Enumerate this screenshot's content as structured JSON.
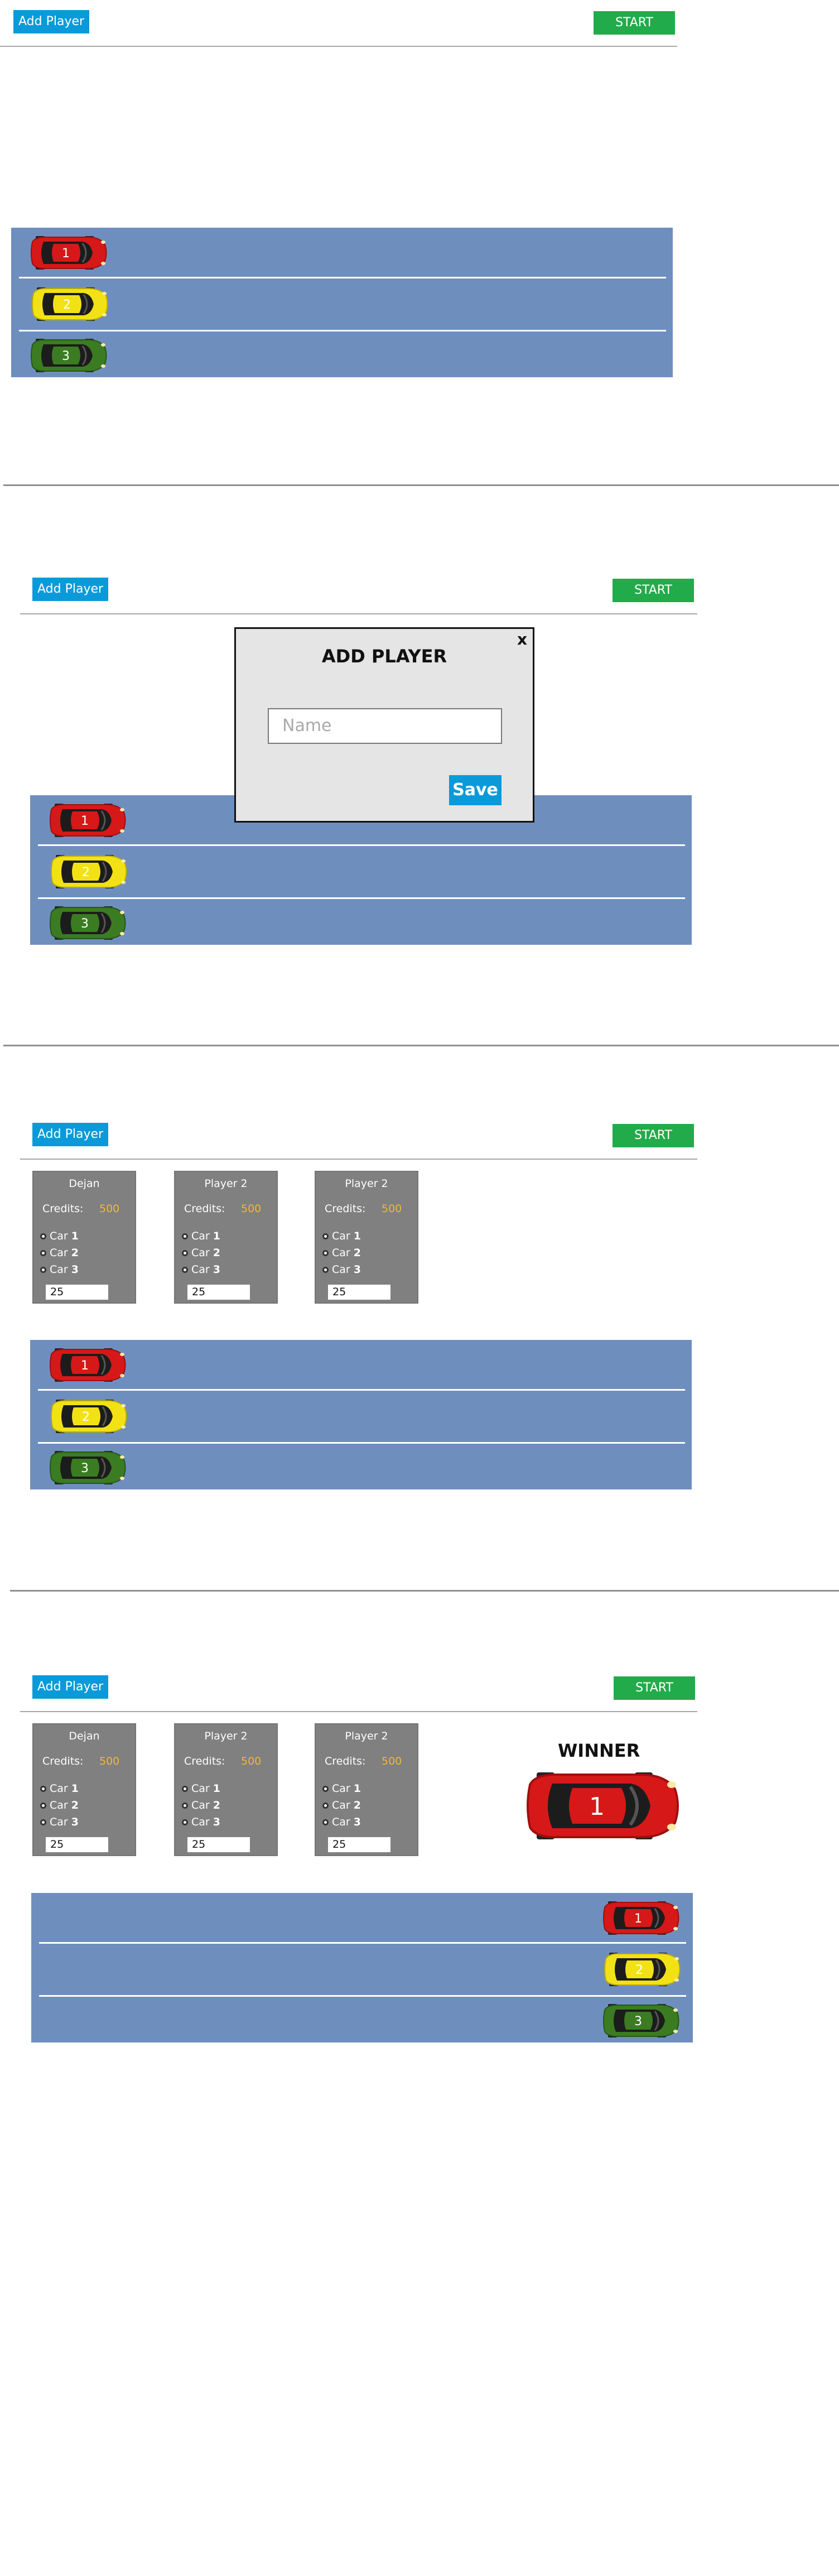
{
  "toolbar": {
    "add_player_label": "Add Player",
    "start_label": "START"
  },
  "cars": [
    {
      "number": "1",
      "color": "#d71818",
      "color_dark": "#9e0f0f"
    },
    {
      "number": "2",
      "color": "#f2e215",
      "color_dark": "#b7aa0a"
    },
    {
      "number": "3",
      "color": "#3b7c22",
      "color_dark": "#275716"
    }
  ],
  "modal": {
    "title": "ADD PLAYER",
    "close_label": "x",
    "name_placeholder": "Name",
    "save_label": "Save"
  },
  "players": [
    {
      "name": "Dejan",
      "credits_label": "Credits:",
      "credits": "500",
      "options": [
        {
          "prefix": "Car",
          "num": "1"
        },
        {
          "prefix": "Car",
          "num": "2"
        },
        {
          "prefix": "Car",
          "num": "3"
        }
      ],
      "bet": "25"
    },
    {
      "name": "Player 2",
      "credits_label": "Credits:",
      "credits": "500",
      "options": [
        {
          "prefix": "Car",
          "num": "1"
        },
        {
          "prefix": "Car",
          "num": "2"
        },
        {
          "prefix": "Car",
          "num": "3"
        }
      ],
      "bet": "25"
    },
    {
      "name": "Player 2",
      "credits_label": "Credits:",
      "credits": "500",
      "options": [
        {
          "prefix": "Car",
          "num": "1"
        },
        {
          "prefix": "Car",
          "num": "2"
        },
        {
          "prefix": "Car",
          "num": "3"
        }
      ],
      "bet": "25"
    }
  ],
  "winner": {
    "title": "WINNER",
    "car_number": "1"
  }
}
